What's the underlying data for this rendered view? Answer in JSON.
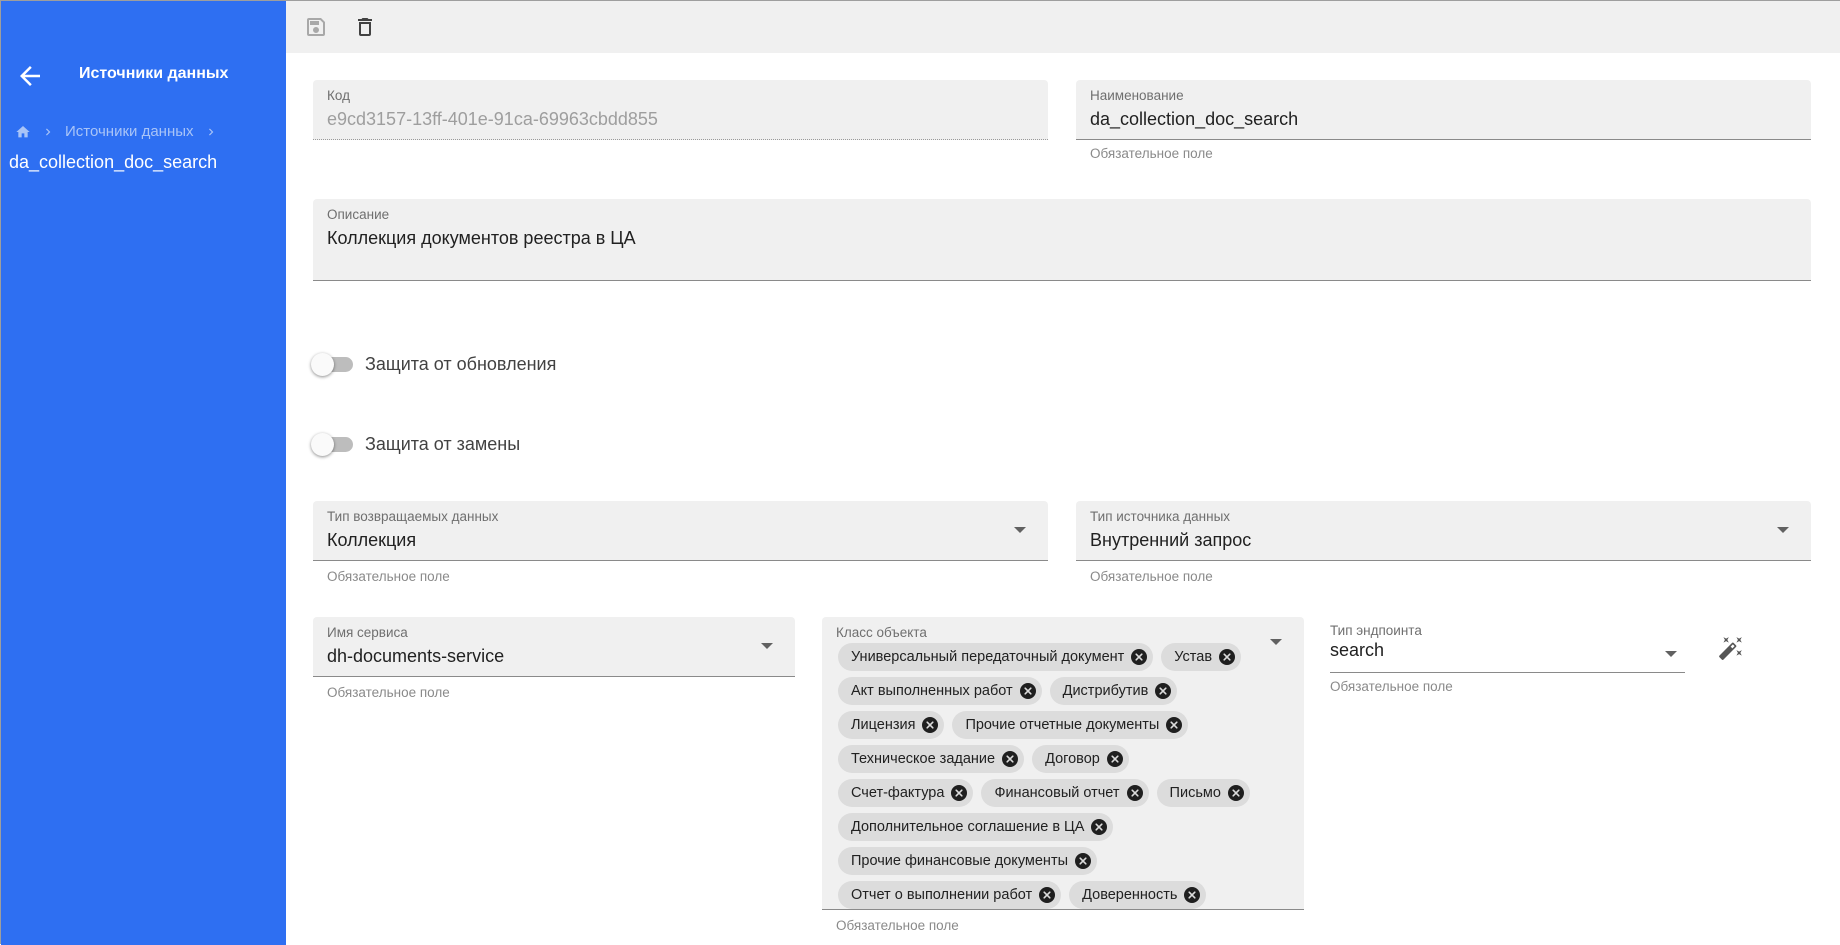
{
  "sidebar": {
    "title": "Источники данных",
    "breadcrumb_link": "Источники данных",
    "current": "da_collection_doc_search",
    "background": "#2e6ff2"
  },
  "toolbar": {
    "icons": [
      "save-icon",
      "delete-icon"
    ]
  },
  "form": {
    "code": {
      "label": "Код",
      "value": "e9cd3157-13ff-401e-91ca-69963cbdd855"
    },
    "name": {
      "label": "Наименование",
      "value": "da_collection_doc_search",
      "hint": "Обязательное поле"
    },
    "description": {
      "label": "Описание",
      "value": "Коллекция документов реестра в ЦА"
    },
    "protect_update": {
      "label": "Защита от обновления",
      "checked": false
    },
    "protect_replace": {
      "label": "Защита от замены",
      "checked": false
    },
    "return_type": {
      "label": "Тип возвращаемых данных",
      "value": "Коллекция",
      "hint": "Обязательное поле"
    },
    "source_type": {
      "label": "Тип источника данных",
      "value": "Внутренний запрос",
      "hint": "Обязательное поле"
    },
    "service_name": {
      "label": "Имя сервиса",
      "value": "dh-documents-service",
      "hint": "Обязательное поле"
    },
    "object_class": {
      "label": "Класс объекта",
      "hint": "Обязательное поле",
      "chips": [
        "Универсальный передаточный документ",
        "Устав",
        "Акт выполненных работ",
        "Дистрибутив",
        "Лицензия",
        "Прочие отчетные документы",
        "Техническое задание",
        "Договор",
        "Счет-фактура",
        "Финансовый отчет",
        "Письмо",
        "Дополнительное соглашение в ЦА",
        "Прочие финансовые документы",
        "Отчет о выполнении работ",
        "Доверенность"
      ]
    },
    "endpoint_type": {
      "label": "Тип эндпоинта",
      "value": "search",
      "hint": "Обязательное поле"
    }
  }
}
